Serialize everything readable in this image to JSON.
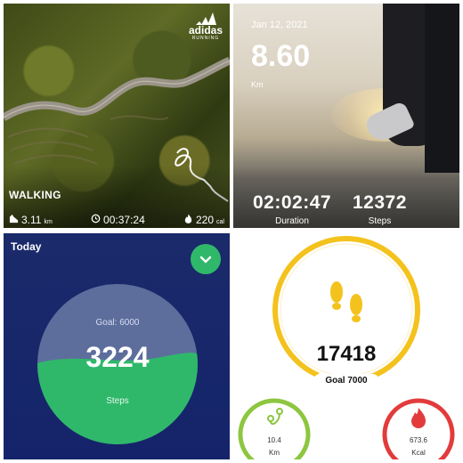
{
  "walking_card": {
    "brand_name": "adidas",
    "brand_sub": "RUNNING",
    "activity": "WALKING",
    "distance_value": "3.11",
    "distance_unit": "km",
    "duration": "00:37:24",
    "calories_value": "220",
    "calories_unit": "cal",
    "icons": [
      "shoe-icon",
      "clock-icon",
      "flame-icon"
    ]
  },
  "run_card": {
    "date": "Jan 12, 2021",
    "distance": "8.60",
    "distance_unit": "Km",
    "duration_value": "02:02:47",
    "duration_label": "Duration",
    "steps_value": "12372",
    "steps_label": "Steps"
  },
  "today_card": {
    "title": "Today",
    "goal_text": "Goal: 6000",
    "steps": "3224",
    "steps_label": "Steps",
    "progress_fraction": 0.54,
    "colors": {
      "background": "#15246a",
      "fill": "#2fb86a",
      "empty": "#5d6e9d"
    }
  },
  "gauge_card": {
    "steps_total": "17418",
    "goal_label": "Goal 7000",
    "distance_value": "10.4",
    "distance_unit": "Km",
    "calories_value": "673.6",
    "calories_unit": "Kcal",
    "colors": {
      "steps": "#f4c21d",
      "distance": "#8dc63f",
      "calories": "#e23b3b"
    }
  }
}
